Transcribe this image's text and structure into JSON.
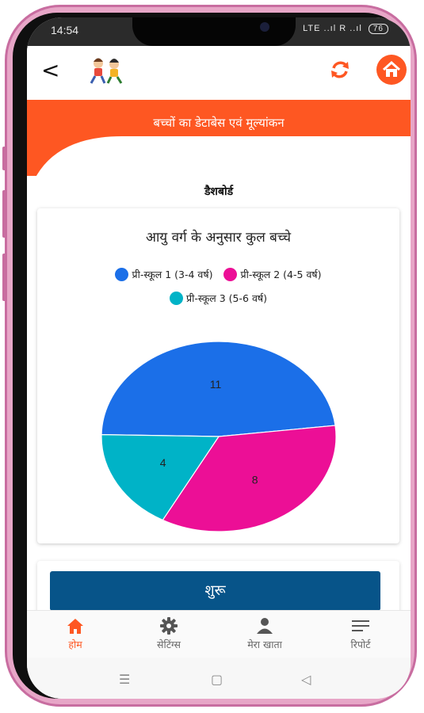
{
  "status_bar": {
    "time": "14:54",
    "signal_text": "LTE ..ıl R ..ıl",
    "battery": "76"
  },
  "header": {
    "back_icon": "back-arrow-icon",
    "logo": "kids-logo",
    "sync_icon": "sync-icon",
    "home_icon": "home-icon"
  },
  "banner": {
    "title": "बच्चों का  डेटाबेस एवं मूल्यांकन"
  },
  "dashboard": {
    "title": "डैशबोर्ड"
  },
  "chart_card": {
    "title": "आयु वर्ग के अनुसार कुल बच्चे"
  },
  "chart_data": {
    "type": "pie",
    "title": "आयु वर्ग के अनुसार कुल बच्चे",
    "legend_position": "top",
    "categories": [
      "प्री-स्कूल 1 (3-4 वर्ष)",
      "प्री-स्कूल 2 (4-5 वर्ष)",
      "प्री-स्कूल 3 (5-6 वर्ष)"
    ],
    "values": [
      11,
      8,
      4
    ],
    "colors": [
      "#1b6fe8",
      "#ec0f96",
      "#00b3c7"
    ]
  },
  "start": {
    "label": "शुरू"
  },
  "bottom_nav": [
    {
      "label": "होम",
      "icon": "home-icon",
      "active": true
    },
    {
      "label": "सेटिंग्स",
      "icon": "gear-icon",
      "active": false
    },
    {
      "label": "मेरा खाता",
      "icon": "person-icon",
      "active": false
    },
    {
      "label": "रिपोर्ट",
      "icon": "menu-lines-icon",
      "active": false
    }
  ],
  "system_nav": {
    "recent": "☰",
    "home": "▢",
    "back": "◁"
  },
  "colors": {
    "accent": "#fe5722",
    "primary_button": "#075489",
    "nav_active": "#fe5722"
  }
}
